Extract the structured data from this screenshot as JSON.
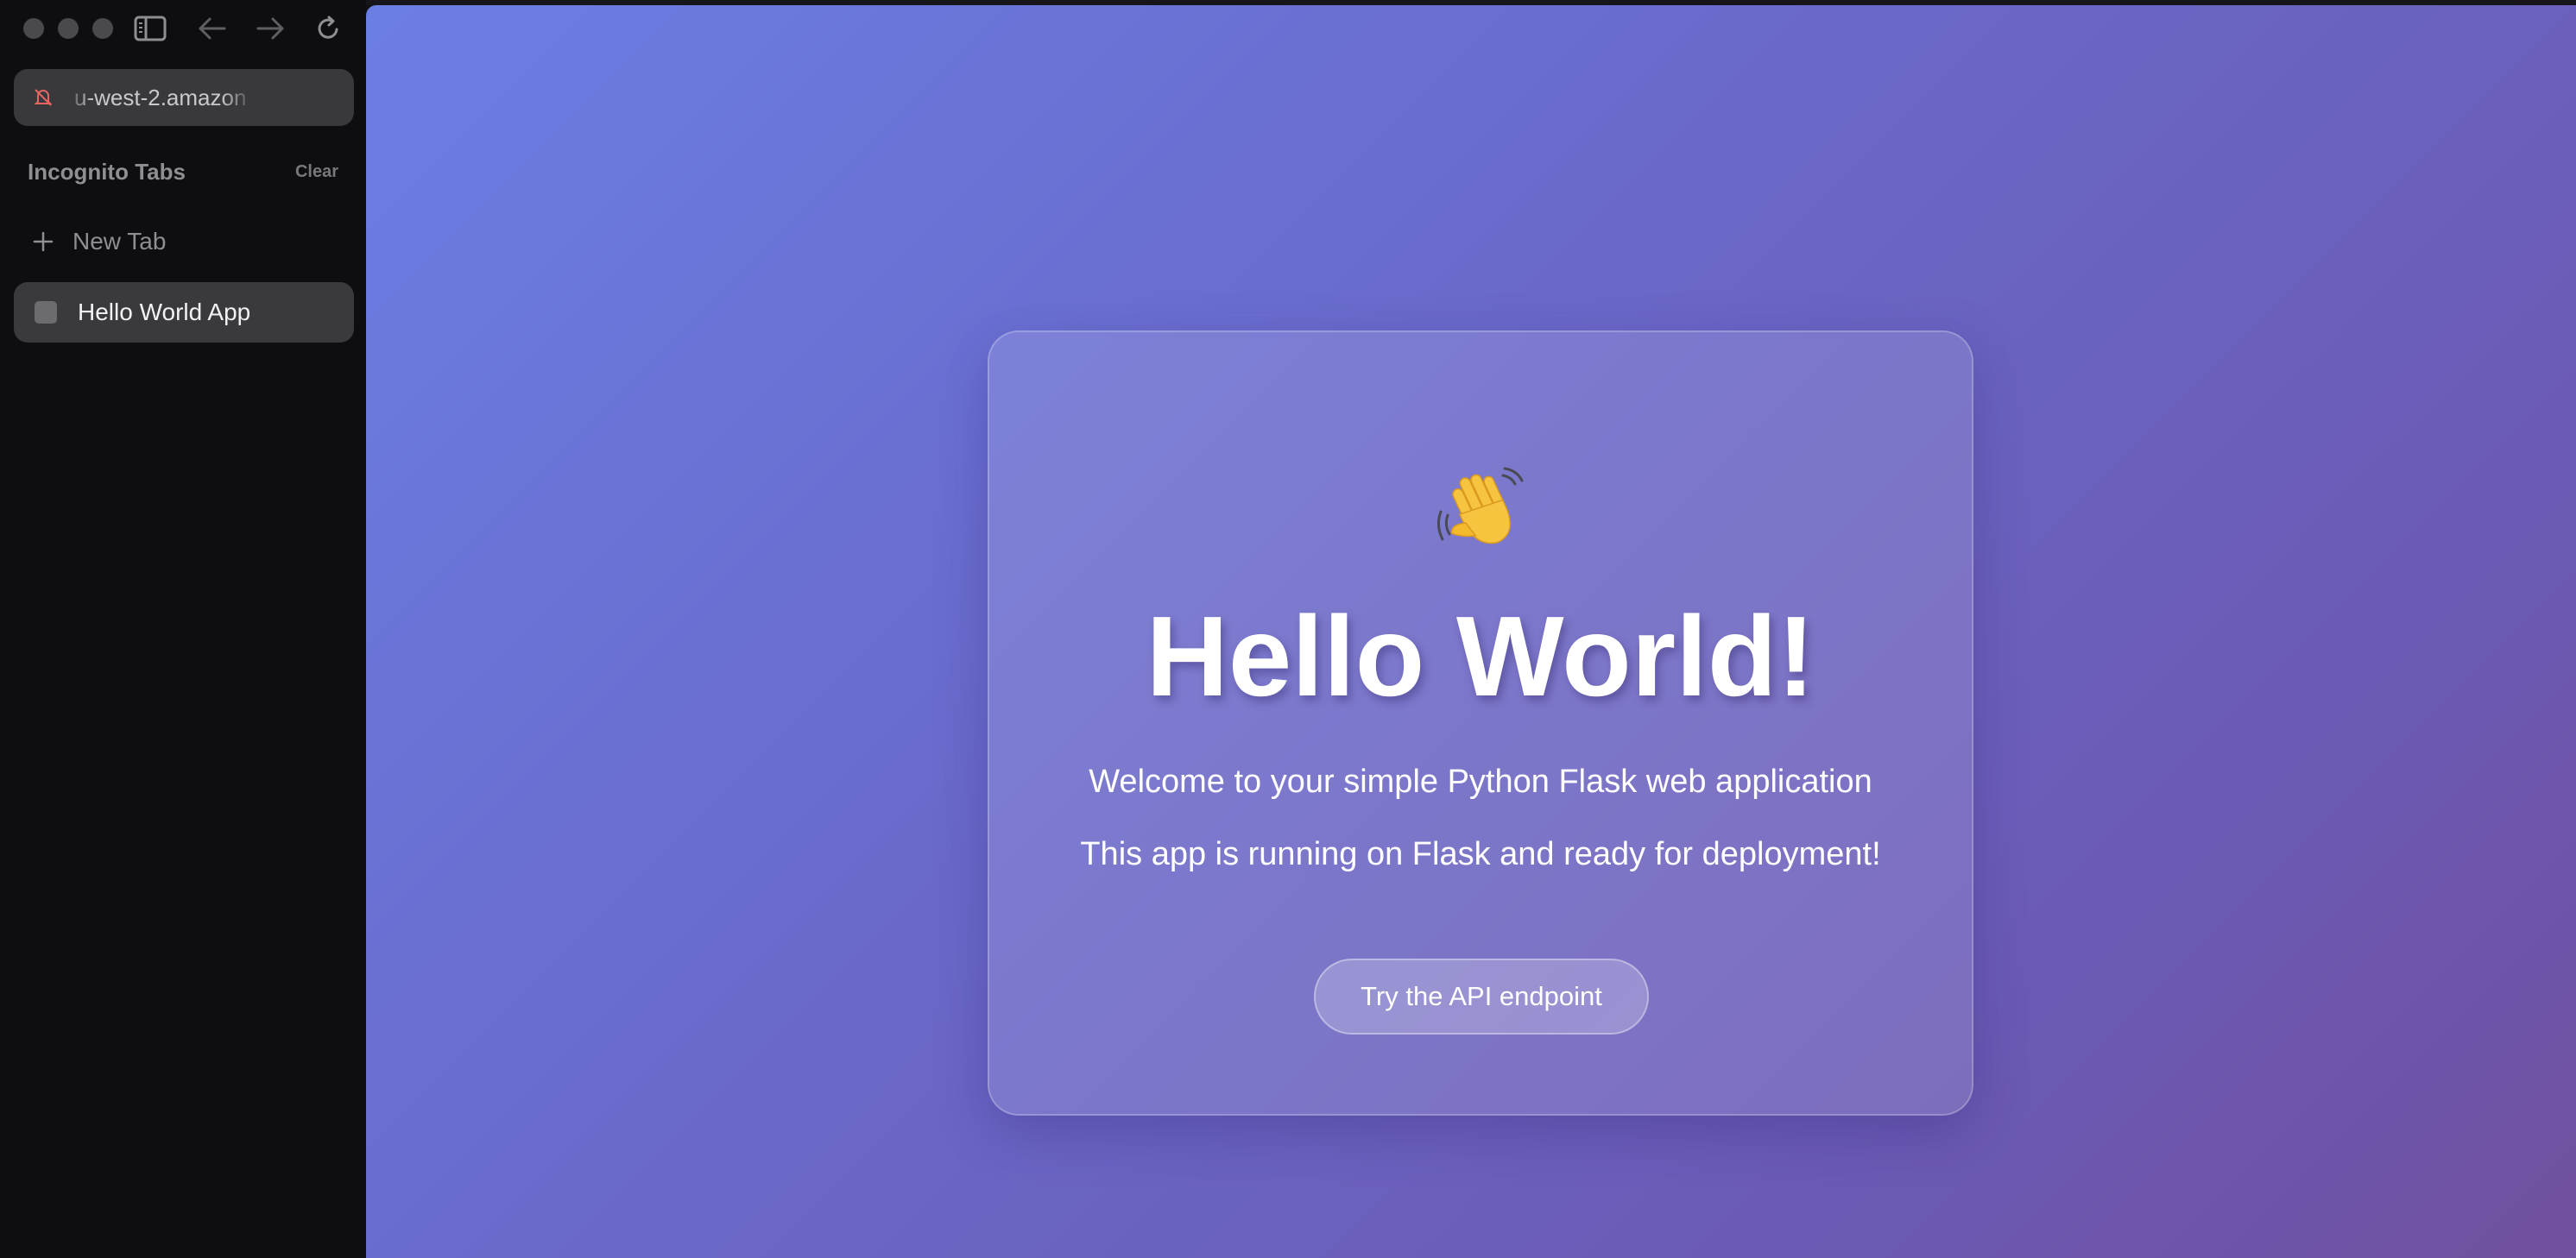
{
  "browser": {
    "url_display": "u-west-2.amazon",
    "sidebar_title": "Incognito Tabs",
    "clear_label": "Clear",
    "new_tab_label": "New Tab",
    "tabs": [
      {
        "label": "Hello World App",
        "active": true
      }
    ]
  },
  "page": {
    "emoji": "👋",
    "headline": "Hello World!",
    "subtitle": "Welcome to your simple Python Flask web application",
    "status_text": "This app is running on Flask and ready for deployment!",
    "api_button_label": "Try the API endpoint"
  },
  "colors": {
    "sidebar_bg": "#0e0e11",
    "urlbar_bg": "#39393d",
    "active_tab_bg": "#3a3a3e",
    "gradient_start": "#6b7ee3",
    "gradient_end": "#70509f",
    "muted_icon": "#e5655f"
  },
  "icons": [
    "traffic-light",
    "sidebar-toggle-icon",
    "back-arrow-icon",
    "forward-arrow-icon",
    "reload-icon",
    "muted-icon",
    "plus-icon",
    "waving-hand-icon"
  ]
}
